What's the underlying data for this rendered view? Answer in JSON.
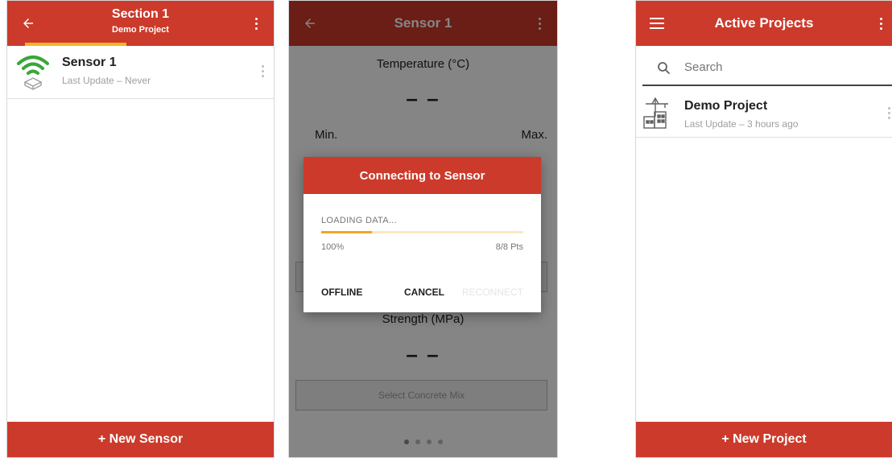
{
  "colors": {
    "primary": "#cc3a2b",
    "accent": "#f5b625",
    "wifi_green": "#3aa63a"
  },
  "screen1": {
    "title": "Section 1",
    "subtitle": "Demo Project",
    "sensors": [
      {
        "name": "Sensor 1",
        "last_update": "Last Update – Never",
        "icon": "wifi-sensor-icon"
      }
    ],
    "new_button": "+ New Sensor"
  },
  "screen2": {
    "title": "Sensor 1",
    "temperature_label": "Temperature (°C)",
    "temperature_value": "– –",
    "min_label": "Min.",
    "max_label": "Max.",
    "strength_label": "Strength (MPa)",
    "strength_value": "– –",
    "concrete_mix_button": "Select Concrete Mix",
    "page_count": 4,
    "active_page": 1,
    "dialog": {
      "title": "Connecting to Sensor",
      "status": "LOADING DATA...",
      "progress": 0.25,
      "percent_text": "100%",
      "points_text": "8/8 Pts",
      "buttons": {
        "offline": "OFFLINE",
        "cancel": "CANCEL",
        "reconnect": "RECONNECT"
      }
    }
  },
  "screen3": {
    "title": "Active Projects",
    "search_placeholder": "Search",
    "projects": [
      {
        "name": "Demo Project",
        "last_update": "Last Update – 3 hours ago",
        "icon": "building-crane-icon"
      }
    ],
    "new_button": "+ New Project"
  }
}
